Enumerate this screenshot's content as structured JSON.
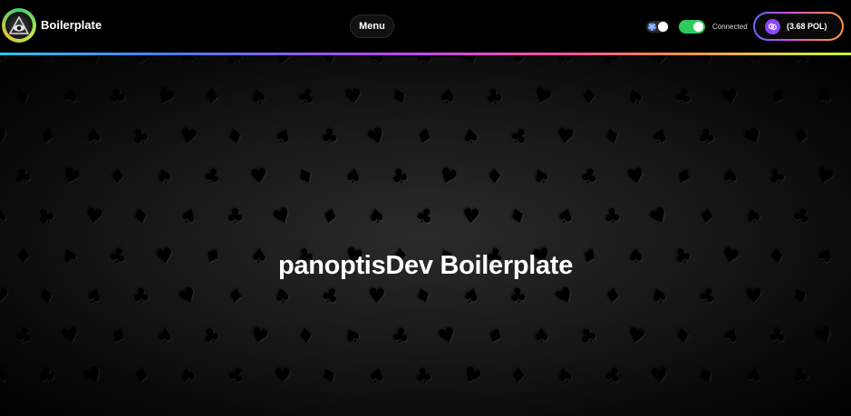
{
  "header": {
    "brand": "Boilerplate",
    "menu_label": "Menu",
    "connection_label": "Connected",
    "connection_on": true,
    "balance_label": "(3.68 POL)"
  },
  "hero": {
    "title": "panoptisDev Boilerplate",
    "background_pattern": "card-suits"
  },
  "icons": {
    "logo": "eye-triangle-logo-icon",
    "theme": "sun-icon",
    "token": "polygon-icon"
  },
  "colors": {
    "connected_toggle": "#2ecc5c",
    "token_purple": "#8a46ff"
  }
}
